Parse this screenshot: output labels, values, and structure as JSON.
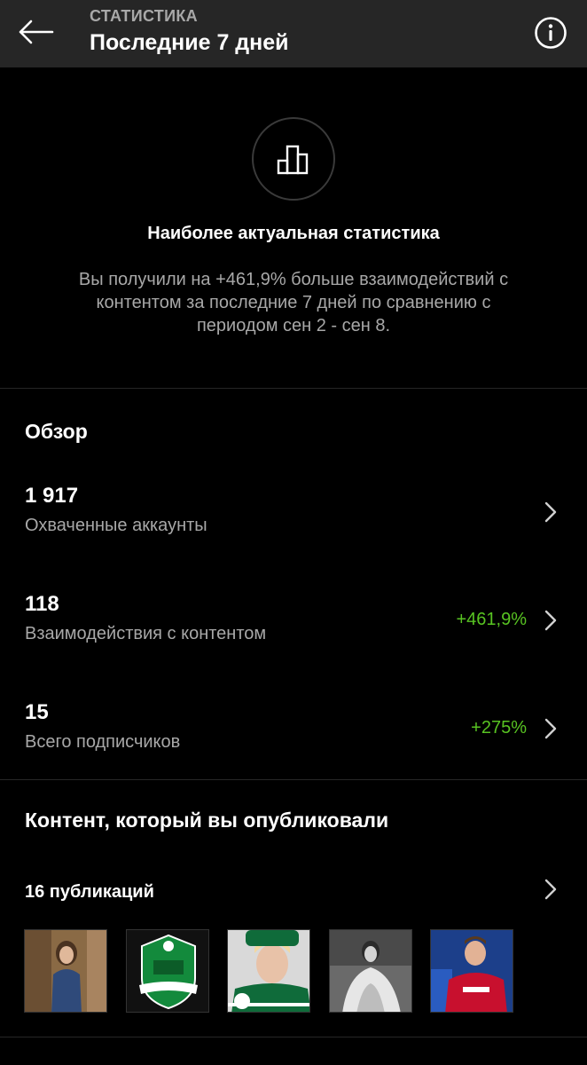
{
  "header": {
    "subtitle": "СТАТИСТИКА",
    "title": "Последние 7 дней"
  },
  "hero": {
    "title": "Наиболее актуальная статистика",
    "description": "Вы получили на +461,9% больше взаимодействий с контентом за последние 7 дней по сравнению с периодом сен 2 - сен 8."
  },
  "overview": {
    "title": "Обзор",
    "stats": [
      {
        "value": "1 917",
        "label": "Охваченные аккаунты",
        "delta": ""
      },
      {
        "value": "118",
        "label": "Взаимодействия с контентом",
        "delta": "+461,9%"
      },
      {
        "value": "15",
        "label": "Всего подписчиков",
        "delta": "+275%"
      }
    ]
  },
  "content": {
    "title": "Контент, который вы опубликовали",
    "publications_label": "16 публикаций"
  },
  "colors": {
    "background": "#000000",
    "header_bg": "#262626",
    "secondary_text": "#a8a8a8",
    "positive": "#58c322"
  },
  "icons": [
    "arrow-left-icon",
    "info-icon",
    "bar-chart-icon",
    "chevron-right-icon"
  ]
}
